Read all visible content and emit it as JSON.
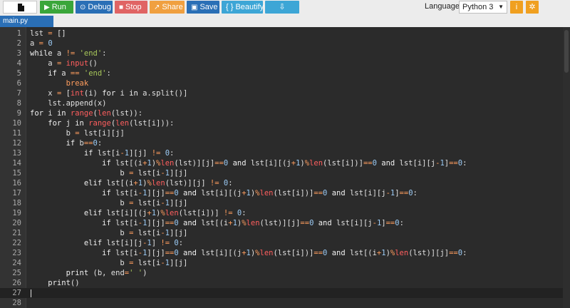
{
  "toolbar": {
    "run": "Run",
    "debug": "Debug",
    "stop": "Stop",
    "share": "Share",
    "save": "Save",
    "beautify": "{ } Beautify",
    "language_label": "Language",
    "language_value": "Python 3",
    "colors": {
      "run": "#3aa63a",
      "debug": "#2a6fb6",
      "stop": "#e06464",
      "share": "#f0a040",
      "save": "#2a6fb6",
      "beautify": "#3da6d6",
      "download": "#3da6d6",
      "info": "#f0a020",
      "settings": "#f0a020"
    },
    "icons": [
      "file-icon",
      "play-icon",
      "debug-icon",
      "stop-icon",
      "share-icon",
      "save-icon",
      "download-icon",
      "info-icon",
      "gear-icon"
    ]
  },
  "tab": {
    "label": "main.py"
  },
  "editor": {
    "cursor_line": 27,
    "lines": [
      {
        "n": "1",
        "tokens": [
          [
            "lst ",
            ""
          ],
          [
            "=",
            "o"
          ],
          [
            " []",
            ""
          ]
        ]
      },
      {
        "n": "2",
        "tokens": [
          [
            "a ",
            ""
          ],
          [
            "=",
            "o"
          ],
          [
            " ",
            ""
          ],
          [
            "0",
            "n"
          ]
        ]
      },
      {
        "n": "3",
        "tokens": [
          [
            "while",
            "k"
          ],
          [
            " a ",
            ""
          ],
          [
            "!=",
            "o"
          ],
          [
            " ",
            ""
          ],
          [
            "'end'",
            "s"
          ],
          [
            ":",
            ""
          ]
        ]
      },
      {
        "n": "4",
        "tokens": [
          [
            "    a ",
            ""
          ],
          [
            "=",
            "o"
          ],
          [
            " ",
            ""
          ],
          [
            "input",
            "f"
          ],
          [
            "()",
            ""
          ]
        ]
      },
      {
        "n": "5",
        "tokens": [
          [
            "    if",
            "k"
          ],
          [
            " a ",
            ""
          ],
          [
            "==",
            "o"
          ],
          [
            " ",
            ""
          ],
          [
            "'end'",
            "s"
          ],
          [
            ":",
            ""
          ]
        ]
      },
      {
        "n": "6",
        "tokens": [
          [
            "        break",
            "o"
          ]
        ]
      },
      {
        "n": "7",
        "tokens": [
          [
            "    x ",
            ""
          ],
          [
            "=",
            "o"
          ],
          [
            " [",
            ""
          ],
          [
            "int",
            "f"
          ],
          [
            "(i) ",
            ""
          ],
          [
            "for",
            "k"
          ],
          [
            " i ",
            ""
          ],
          [
            "in",
            "k"
          ],
          [
            " a.split()]",
            ""
          ]
        ]
      },
      {
        "n": "8",
        "tokens": [
          [
            "    lst.append(x)",
            ""
          ]
        ]
      },
      {
        "n": "9",
        "tokens": [
          [
            "for",
            "k"
          ],
          [
            " i ",
            ""
          ],
          [
            "in",
            "k"
          ],
          [
            " ",
            ""
          ],
          [
            "range",
            "f"
          ],
          [
            "(",
            ""
          ],
          [
            "len",
            "f"
          ],
          [
            "(lst)):",
            ""
          ]
        ]
      },
      {
        "n": "10",
        "tokens": [
          [
            "    for",
            "k"
          ],
          [
            " j ",
            ""
          ],
          [
            "in",
            "k"
          ],
          [
            " ",
            ""
          ],
          [
            "range",
            "f"
          ],
          [
            "(",
            ""
          ],
          [
            "len",
            "f"
          ],
          [
            "(lst[i])):",
            ""
          ]
        ]
      },
      {
        "n": "11",
        "tokens": [
          [
            "        b ",
            ""
          ],
          [
            "=",
            "o"
          ],
          [
            " lst[i][j]",
            ""
          ]
        ]
      },
      {
        "n": "12",
        "tokens": [
          [
            "        if",
            "k"
          ],
          [
            " b",
            ""
          ],
          [
            "==",
            "o"
          ],
          [
            "0",
            "n"
          ],
          [
            ":",
            ""
          ]
        ]
      },
      {
        "n": "13",
        "tokens": [
          [
            "            if",
            "k"
          ],
          [
            " lst[i",
            ""
          ],
          [
            "-",
            "o"
          ],
          [
            "1",
            "n"
          ],
          [
            "][j] ",
            ""
          ],
          [
            "!=",
            "o"
          ],
          [
            " ",
            ""
          ],
          [
            "0",
            "n"
          ],
          [
            ":",
            ""
          ]
        ]
      },
      {
        "n": "14",
        "tokens": [
          [
            "                if",
            "k"
          ],
          [
            " lst[(i",
            ""
          ],
          [
            "+",
            "o"
          ],
          [
            "1",
            "n"
          ],
          [
            ")",
            ""
          ],
          [
            "%",
            "o"
          ],
          [
            "len",
            "f"
          ],
          [
            "(lst)][j]",
            ""
          ],
          [
            "==",
            "o"
          ],
          [
            "0",
            "n"
          ],
          [
            " ",
            ""
          ],
          [
            "and",
            "k"
          ],
          [
            " lst[i][(j",
            ""
          ],
          [
            "+",
            "o"
          ],
          [
            "1",
            "n"
          ],
          [
            ")",
            ""
          ],
          [
            "%",
            "o"
          ],
          [
            "len",
            "f"
          ],
          [
            "(lst[i])]",
            ""
          ],
          [
            "==",
            "o"
          ],
          [
            "0",
            "n"
          ],
          [
            " ",
            ""
          ],
          [
            "and",
            "k"
          ],
          [
            " lst[i][j",
            ""
          ],
          [
            "-",
            "o"
          ],
          [
            "1",
            "n"
          ],
          [
            "]",
            ""
          ],
          [
            "==",
            "o"
          ],
          [
            "0",
            "n"
          ],
          [
            ":",
            ""
          ]
        ]
      },
      {
        "n": "15",
        "tokens": [
          [
            "                    b ",
            ""
          ],
          [
            "=",
            "o"
          ],
          [
            " lst[i",
            ""
          ],
          [
            "-",
            "o"
          ],
          [
            "1",
            "n"
          ],
          [
            "][j]",
            ""
          ]
        ]
      },
      {
        "n": "16",
        "tokens": [
          [
            "            elif",
            "k"
          ],
          [
            " lst[(i",
            ""
          ],
          [
            "+",
            "o"
          ],
          [
            "1",
            "n"
          ],
          [
            ")",
            ""
          ],
          [
            "%",
            "o"
          ],
          [
            "len",
            "f"
          ],
          [
            "(lst)][j] ",
            ""
          ],
          [
            "!=",
            "o"
          ],
          [
            " ",
            ""
          ],
          [
            "0",
            "n"
          ],
          [
            ":",
            ""
          ]
        ]
      },
      {
        "n": "17",
        "tokens": [
          [
            "                if",
            "k"
          ],
          [
            " lst[i",
            ""
          ],
          [
            "-",
            "o"
          ],
          [
            "1",
            "n"
          ],
          [
            "][j]",
            ""
          ],
          [
            "==",
            "o"
          ],
          [
            "0",
            "n"
          ],
          [
            " ",
            ""
          ],
          [
            "and",
            "k"
          ],
          [
            " lst[i][(j",
            ""
          ],
          [
            "+",
            "o"
          ],
          [
            "1",
            "n"
          ],
          [
            ")",
            ""
          ],
          [
            "%",
            "o"
          ],
          [
            "len",
            "f"
          ],
          [
            "(lst[i])]",
            ""
          ],
          [
            "==",
            "o"
          ],
          [
            "0",
            "n"
          ],
          [
            " ",
            ""
          ],
          [
            "and",
            "k"
          ],
          [
            " lst[i][j",
            ""
          ],
          [
            "-",
            "o"
          ],
          [
            "1",
            "n"
          ],
          [
            "]",
            ""
          ],
          [
            "==",
            "o"
          ],
          [
            "0",
            "n"
          ],
          [
            ":",
            ""
          ]
        ]
      },
      {
        "n": "18",
        "tokens": [
          [
            "                    b ",
            ""
          ],
          [
            "=",
            "o"
          ],
          [
            " lst[i",
            ""
          ],
          [
            "-",
            "o"
          ],
          [
            "1",
            "n"
          ],
          [
            "][j]",
            ""
          ]
        ]
      },
      {
        "n": "19",
        "tokens": [
          [
            "            elif",
            "k"
          ],
          [
            " lst[i][(j",
            ""
          ],
          [
            "+",
            "o"
          ],
          [
            "1",
            "n"
          ],
          [
            ")",
            ""
          ],
          [
            "%",
            "o"
          ],
          [
            "len",
            "f"
          ],
          [
            "(lst[i])] ",
            ""
          ],
          [
            "!=",
            "o"
          ],
          [
            " ",
            ""
          ],
          [
            "0",
            "n"
          ],
          [
            ":",
            ""
          ]
        ]
      },
      {
        "n": "20",
        "tokens": [
          [
            "                if",
            "k"
          ],
          [
            " lst[i",
            ""
          ],
          [
            "-",
            "o"
          ],
          [
            "1",
            "n"
          ],
          [
            "][j]",
            ""
          ],
          [
            "==",
            "o"
          ],
          [
            "0",
            "n"
          ],
          [
            " ",
            ""
          ],
          [
            "and",
            "k"
          ],
          [
            " lst[(i",
            ""
          ],
          [
            "+",
            "o"
          ],
          [
            "1",
            "n"
          ],
          [
            ")",
            ""
          ],
          [
            "%",
            "o"
          ],
          [
            "len",
            "f"
          ],
          [
            "(lst)][j]",
            ""
          ],
          [
            "==",
            "o"
          ],
          [
            "0",
            "n"
          ],
          [
            " ",
            ""
          ],
          [
            "and",
            "k"
          ],
          [
            " lst[i][j",
            ""
          ],
          [
            "-",
            "o"
          ],
          [
            "1",
            "n"
          ],
          [
            "]",
            ""
          ],
          [
            "==",
            "o"
          ],
          [
            "0",
            "n"
          ],
          [
            ":",
            ""
          ]
        ]
      },
      {
        "n": "21",
        "tokens": [
          [
            "                    b ",
            ""
          ],
          [
            "=",
            "o"
          ],
          [
            " lst[i",
            ""
          ],
          [
            "-",
            "o"
          ],
          [
            "1",
            "n"
          ],
          [
            "][j]",
            ""
          ]
        ]
      },
      {
        "n": "22",
        "tokens": [
          [
            "            elif",
            "k"
          ],
          [
            " lst[i][j",
            ""
          ],
          [
            "-",
            "o"
          ],
          [
            "1",
            "n"
          ],
          [
            "] ",
            ""
          ],
          [
            "!=",
            "o"
          ],
          [
            " ",
            ""
          ],
          [
            "0",
            "n"
          ],
          [
            ":",
            ""
          ]
        ]
      },
      {
        "n": "23",
        "tokens": [
          [
            "                if",
            "k"
          ],
          [
            " lst[i",
            ""
          ],
          [
            "-",
            "o"
          ],
          [
            "1",
            "n"
          ],
          [
            "][j]",
            ""
          ],
          [
            "==",
            "o"
          ],
          [
            "0",
            "n"
          ],
          [
            " ",
            ""
          ],
          [
            "and",
            "k"
          ],
          [
            " lst[i][(j",
            ""
          ],
          [
            "+",
            "o"
          ],
          [
            "1",
            "n"
          ],
          [
            ")",
            ""
          ],
          [
            "%",
            "o"
          ],
          [
            "len",
            "f"
          ],
          [
            "(lst[i])]",
            ""
          ],
          [
            "==",
            "o"
          ],
          [
            "0",
            "n"
          ],
          [
            " ",
            ""
          ],
          [
            "and",
            "k"
          ],
          [
            " lst[(i",
            ""
          ],
          [
            "+",
            "o"
          ],
          [
            "1",
            "n"
          ],
          [
            ")",
            ""
          ],
          [
            "%",
            "o"
          ],
          [
            "len",
            "f"
          ],
          [
            "(lst)][j]",
            ""
          ],
          [
            "==",
            "o"
          ],
          [
            "0",
            "n"
          ],
          [
            ":",
            ""
          ]
        ]
      },
      {
        "n": "24",
        "tokens": [
          [
            "                    b ",
            ""
          ],
          [
            "=",
            "o"
          ],
          [
            " lst[i",
            ""
          ],
          [
            "-",
            "o"
          ],
          [
            "1",
            "n"
          ],
          [
            "][j]",
            ""
          ]
        ]
      },
      {
        "n": "25",
        "tokens": [
          [
            "        print",
            "k"
          ],
          [
            " (b, end",
            ""
          ],
          [
            "=",
            "o"
          ],
          [
            "' '",
            "s"
          ],
          [
            ")",
            ""
          ]
        ]
      },
      {
        "n": "26",
        "tokens": [
          [
            "    print",
            "k"
          ],
          [
            "()",
            ""
          ]
        ]
      },
      {
        "n": "27",
        "tokens": []
      },
      {
        "n": "28",
        "tokens": []
      }
    ]
  }
}
